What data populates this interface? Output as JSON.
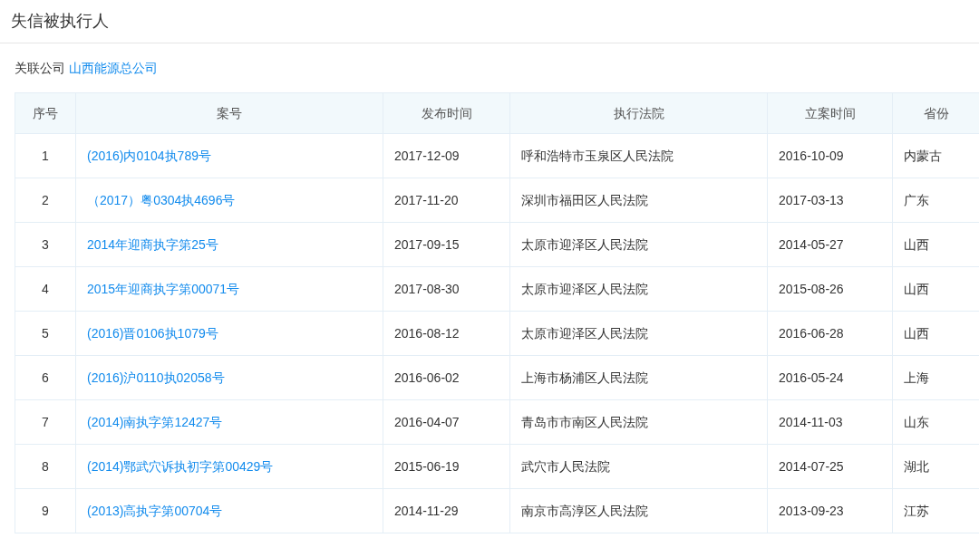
{
  "title": "失信被执行人",
  "related": {
    "label": "关联公司",
    "company": "山西能源总公司"
  },
  "table": {
    "columns": [
      "序号",
      "案号",
      "发布时间",
      "执行法院",
      "立案时间",
      "省份"
    ],
    "rows": [
      [
        "1",
        "(2016)内0104执789号",
        "2017-12-09",
        "呼和浩特市玉泉区人民法院",
        "2016-10-09",
        "内蒙古"
      ],
      [
        "2",
        "（2017）粤0304执4696号",
        "2017-11-20",
        "深圳市福田区人民法院",
        "2017-03-13",
        "广东"
      ],
      [
        "3",
        "2014年迎商执字第25号",
        "2017-09-15",
        "太原市迎泽区人民法院",
        "2014-05-27",
        "山西"
      ],
      [
        "4",
        "2015年迎商执字第00071号",
        "2017-08-30",
        "太原市迎泽区人民法院",
        "2015-08-26",
        "山西"
      ],
      [
        "5",
        "(2016)晋0106执1079号",
        "2016-08-12",
        "太原市迎泽区人民法院",
        "2016-06-28",
        "山西"
      ],
      [
        "6",
        "(2016)沪0110执02058号",
        "2016-06-02",
        "上海市杨浦区人民法院",
        "2016-05-24",
        "上海"
      ],
      [
        "7",
        "(2014)南执字第12427号",
        "2016-04-07",
        "青岛市市南区人民法院",
        "2014-11-03",
        "山东"
      ],
      [
        "8",
        "(2014)鄂武穴诉执初字第00429号",
        "2015-06-19",
        "武穴市人民法院",
        "2014-07-25",
        "湖北"
      ],
      [
        "9",
        "(2013)高执字第00704号",
        "2014-11-29",
        "南京市高淳区人民法院",
        "2013-09-23",
        "江苏"
      ]
    ]
  }
}
